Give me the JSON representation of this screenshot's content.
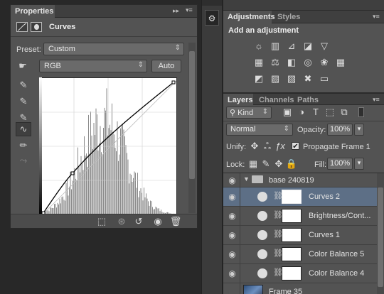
{
  "properties": {
    "tab": "Properties",
    "title": "Curves",
    "preset_label": "Preset:",
    "preset_value": "Custom",
    "channel_value": "RGB",
    "auto_label": "Auto"
  },
  "adjustments": {
    "tabs": [
      "Adjustments",
      "Styles"
    ],
    "heading": "Add an adjustment"
  },
  "layers_panel": {
    "tabs": [
      "Layers",
      "Channels",
      "Paths"
    ],
    "filter_kind": "Kind",
    "blend_mode": "Normal",
    "opacity_label": "Opacity:",
    "opacity_value": "100%",
    "unify_label": "Unify:",
    "propagate_label": "Propagate Frame 1",
    "lock_label": "Lock:",
    "fill_label": "Fill:",
    "fill_value": "100%",
    "group_name": "base 240819",
    "layers": [
      {
        "name": "Curves 2"
      },
      {
        "name": "Brightness/Cont..."
      },
      {
        "name": "Curves 1"
      },
      {
        "name": "Color Balance 5"
      },
      {
        "name": "Color Balance 4"
      }
    ],
    "frame_name": "Frame 35"
  }
}
